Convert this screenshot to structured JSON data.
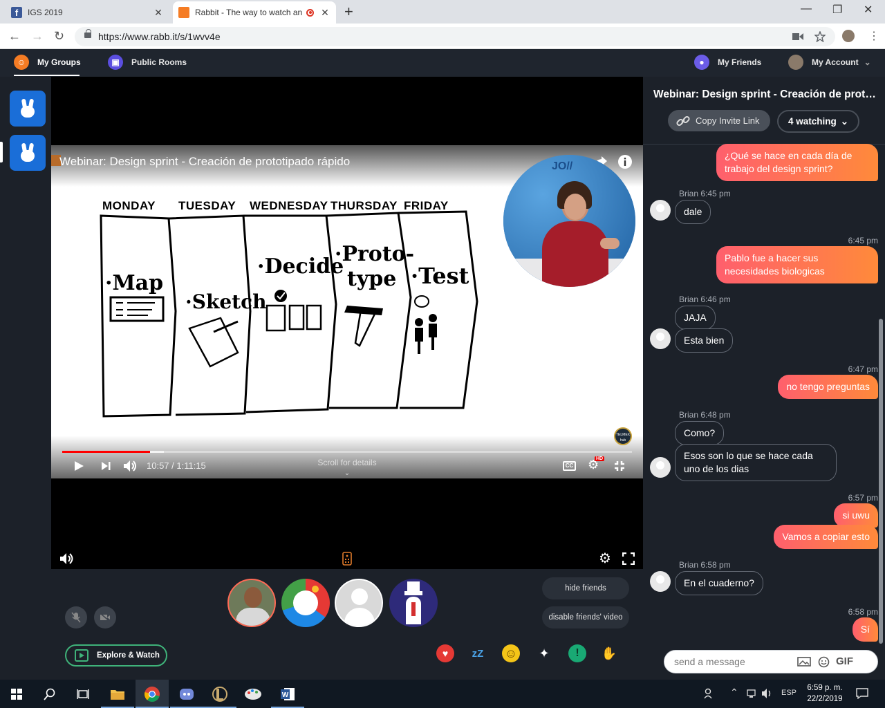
{
  "browser": {
    "tabs": [
      {
        "title": "IGS 2019",
        "close": "✕"
      },
      {
        "title": "Rabbit - The way to watch an",
        "close": "✕"
      }
    ],
    "new_tab": "+",
    "window": {
      "minimize": "—",
      "restore": "❐",
      "close": "✕"
    },
    "url": "https://www.rabb.it/s/1wvv4e"
  },
  "app_header": {
    "my_groups": "My Groups",
    "public_rooms": "Public Rooms",
    "my_friends": "My Friends",
    "my_account": "My Account"
  },
  "video": {
    "title": "Webinar: Design sprint - Creación de prototipado rápido",
    "days": [
      "MONDAY",
      "TUESDAY",
      "WEDNESDAY",
      "THURSDAY",
      "FRIDAY"
    ],
    "steps": [
      "·Map",
      "·Sketch",
      "·Decide",
      "·Proto-",
      "type",
      "·Test"
    ],
    "time": "10:57 / 1:11:15",
    "progress_fraction": 0.154,
    "buffered_fraction": 0.178,
    "scroll_hint": "Scroll for details",
    "cc": "CC",
    "hd": "HD",
    "presenter_logo": "JO//",
    "channel_badge": "TELMEX hub"
  },
  "stage_controls": {
    "hide_friends": "hide friends",
    "disable_video": "disable friends' video",
    "explore_watch": "Explore & Watch",
    "reactions": [
      "♥",
      "zZ",
      "☺",
      "✦",
      "!",
      "✋"
    ]
  },
  "chat": {
    "title": "Webinar: Design sprint - Creación de prototipado rápido",
    "copy_invite": "Copy Invite Link",
    "watching": "4 watching",
    "messages": [
      {
        "dir": "out",
        "text": "¿Qué se hace en cada día de trabajo del design sprint?"
      },
      {
        "dir": "in",
        "meta": "Brian  6:45 pm",
        "texts": [
          "dale"
        ]
      },
      {
        "dir": "out",
        "meta": "6:45 pm",
        "text": "Pablo fue a hacer sus necesidades biologicas"
      },
      {
        "dir": "in",
        "meta": "Brian  6:46 pm",
        "texts": [
          "JAJA",
          "Esta bien"
        ]
      },
      {
        "dir": "out",
        "meta": "6:47 pm",
        "text": "no tengo preguntas"
      },
      {
        "dir": "in",
        "meta": "Brian  6:48 pm",
        "texts": [
          "Como?",
          "Esos son lo que se hace cada uno de los dias"
        ]
      },
      {
        "dir": "out",
        "meta": "6:57 pm",
        "texts": [
          "si uwu",
          "Vamos a copiar esto"
        ]
      },
      {
        "dir": "in",
        "meta": "Brian  6:58 pm",
        "texts": [
          "En el cuaderno?"
        ]
      },
      {
        "dir": "out",
        "meta": "6:58 pm",
        "text": "Sí"
      }
    ],
    "input_placeholder": "send a message",
    "gif": "GIF"
  },
  "taskbar": {
    "lang": "ESP",
    "time": "6:59 p. m.",
    "date": "22/2/2019"
  },
  "colors": {
    "accent": "#ff6a55",
    "header_bg": "#1f252e",
    "chat_bg": "#1c2129",
    "rail_blue": "#1a6ed8",
    "explore_green": "#3fb37a",
    "progress_red": "#ff0000"
  }
}
